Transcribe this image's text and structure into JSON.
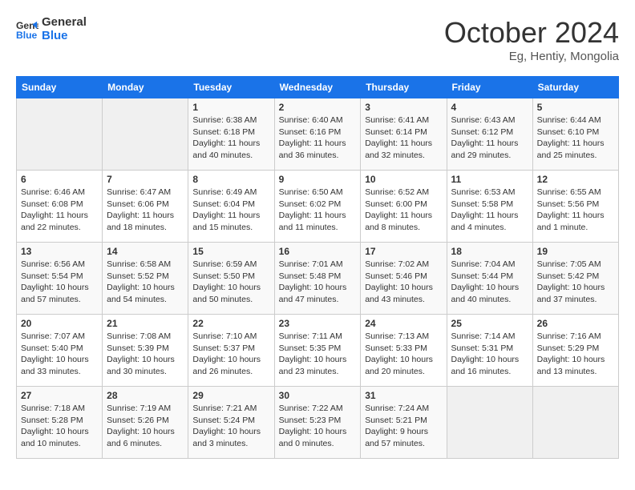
{
  "header": {
    "logo_line1": "General",
    "logo_line2": "Blue",
    "month": "October 2024",
    "location": "Eg, Hentiy, Mongolia"
  },
  "weekdays": [
    "Sunday",
    "Monday",
    "Tuesday",
    "Wednesday",
    "Thursday",
    "Friday",
    "Saturday"
  ],
  "rows": [
    [
      {
        "day": "",
        "empty": true
      },
      {
        "day": "",
        "empty": true
      },
      {
        "day": "1",
        "sunrise": "6:38 AM",
        "sunset": "6:18 PM",
        "daylight": "Daylight: 11 hours and 40 minutes."
      },
      {
        "day": "2",
        "sunrise": "6:40 AM",
        "sunset": "6:16 PM",
        "daylight": "Daylight: 11 hours and 36 minutes."
      },
      {
        "day": "3",
        "sunrise": "6:41 AM",
        "sunset": "6:14 PM",
        "daylight": "Daylight: 11 hours and 32 minutes."
      },
      {
        "day": "4",
        "sunrise": "6:43 AM",
        "sunset": "6:12 PM",
        "daylight": "Daylight: 11 hours and 29 minutes."
      },
      {
        "day": "5",
        "sunrise": "6:44 AM",
        "sunset": "6:10 PM",
        "daylight": "Daylight: 11 hours and 25 minutes."
      }
    ],
    [
      {
        "day": "6",
        "sunrise": "6:46 AM",
        "sunset": "6:08 PM",
        "daylight": "Daylight: 11 hours and 22 minutes."
      },
      {
        "day": "7",
        "sunrise": "6:47 AM",
        "sunset": "6:06 PM",
        "daylight": "Daylight: 11 hours and 18 minutes."
      },
      {
        "day": "8",
        "sunrise": "6:49 AM",
        "sunset": "6:04 PM",
        "daylight": "Daylight: 11 hours and 15 minutes."
      },
      {
        "day": "9",
        "sunrise": "6:50 AM",
        "sunset": "6:02 PM",
        "daylight": "Daylight: 11 hours and 11 minutes."
      },
      {
        "day": "10",
        "sunrise": "6:52 AM",
        "sunset": "6:00 PM",
        "daylight": "Daylight: 11 hours and 8 minutes."
      },
      {
        "day": "11",
        "sunrise": "6:53 AM",
        "sunset": "5:58 PM",
        "daylight": "Daylight: 11 hours and 4 minutes."
      },
      {
        "day": "12",
        "sunrise": "6:55 AM",
        "sunset": "5:56 PM",
        "daylight": "Daylight: 11 hours and 1 minute."
      }
    ],
    [
      {
        "day": "13",
        "sunrise": "6:56 AM",
        "sunset": "5:54 PM",
        "daylight": "Daylight: 10 hours and 57 minutes."
      },
      {
        "day": "14",
        "sunrise": "6:58 AM",
        "sunset": "5:52 PM",
        "daylight": "Daylight: 10 hours and 54 minutes."
      },
      {
        "day": "15",
        "sunrise": "6:59 AM",
        "sunset": "5:50 PM",
        "daylight": "Daylight: 10 hours and 50 minutes."
      },
      {
        "day": "16",
        "sunrise": "7:01 AM",
        "sunset": "5:48 PM",
        "daylight": "Daylight: 10 hours and 47 minutes."
      },
      {
        "day": "17",
        "sunrise": "7:02 AM",
        "sunset": "5:46 PM",
        "daylight": "Daylight: 10 hours and 43 minutes."
      },
      {
        "day": "18",
        "sunrise": "7:04 AM",
        "sunset": "5:44 PM",
        "daylight": "Daylight: 10 hours and 40 minutes."
      },
      {
        "day": "19",
        "sunrise": "7:05 AM",
        "sunset": "5:42 PM",
        "daylight": "Daylight: 10 hours and 37 minutes."
      }
    ],
    [
      {
        "day": "20",
        "sunrise": "7:07 AM",
        "sunset": "5:40 PM",
        "daylight": "Daylight: 10 hours and 33 minutes."
      },
      {
        "day": "21",
        "sunrise": "7:08 AM",
        "sunset": "5:39 PM",
        "daylight": "Daylight: 10 hours and 30 minutes."
      },
      {
        "day": "22",
        "sunrise": "7:10 AM",
        "sunset": "5:37 PM",
        "daylight": "Daylight: 10 hours and 26 minutes."
      },
      {
        "day": "23",
        "sunrise": "7:11 AM",
        "sunset": "5:35 PM",
        "daylight": "Daylight: 10 hours and 23 minutes."
      },
      {
        "day": "24",
        "sunrise": "7:13 AM",
        "sunset": "5:33 PM",
        "daylight": "Daylight: 10 hours and 20 minutes."
      },
      {
        "day": "25",
        "sunrise": "7:14 AM",
        "sunset": "5:31 PM",
        "daylight": "Daylight: 10 hours and 16 minutes."
      },
      {
        "day": "26",
        "sunrise": "7:16 AM",
        "sunset": "5:29 PM",
        "daylight": "Daylight: 10 hours and 13 minutes."
      }
    ],
    [
      {
        "day": "27",
        "sunrise": "7:18 AM",
        "sunset": "5:28 PM",
        "daylight": "Daylight: 10 hours and 10 minutes."
      },
      {
        "day": "28",
        "sunrise": "7:19 AM",
        "sunset": "5:26 PM",
        "daylight": "Daylight: 10 hours and 6 minutes."
      },
      {
        "day": "29",
        "sunrise": "7:21 AM",
        "sunset": "5:24 PM",
        "daylight": "Daylight: 10 hours and 3 minutes."
      },
      {
        "day": "30",
        "sunrise": "7:22 AM",
        "sunset": "5:23 PM",
        "daylight": "Daylight: 10 hours and 0 minutes."
      },
      {
        "day": "31",
        "sunrise": "7:24 AM",
        "sunset": "5:21 PM",
        "daylight": "Daylight: 9 hours and 57 minutes."
      },
      {
        "day": "",
        "empty": true
      },
      {
        "day": "",
        "empty": true
      }
    ]
  ]
}
